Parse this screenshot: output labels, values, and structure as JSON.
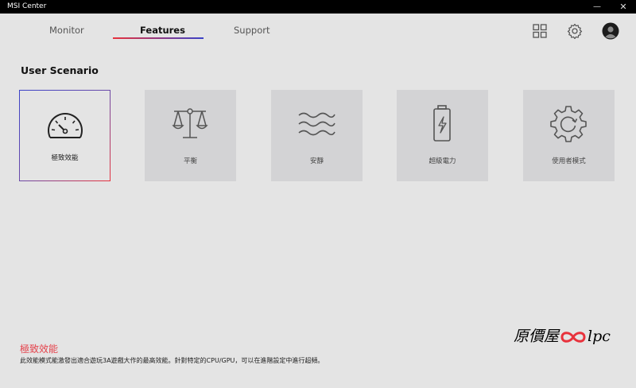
{
  "window": {
    "title": "MSI Center",
    "minimize_glyph": "—",
    "close_glyph": "✕"
  },
  "tabs": [
    {
      "label": "Monitor",
      "active": false
    },
    {
      "label": "Features",
      "active": true
    },
    {
      "label": "Support",
      "active": false
    }
  ],
  "header_icons": [
    "grid-icon",
    "gear-icon",
    "avatar-icon"
  ],
  "section_title": "User Scenario",
  "scenarios": [
    {
      "label": "極致效能",
      "icon": "speedometer-icon",
      "selected": true
    },
    {
      "label": "平衡",
      "icon": "balance-scale-icon",
      "selected": false
    },
    {
      "label": "安靜",
      "icon": "waves-icon",
      "selected": false
    },
    {
      "label": "超級電力",
      "icon": "battery-charging-icon",
      "selected": false
    },
    {
      "label": "使用者模式",
      "icon": "gear-icon",
      "selected": false
    }
  ],
  "description": {
    "title": "極致效能",
    "text": "此效能模式能激發出適合遊玩3A遊戲大作的最高效能。針對特定的CPU/GPU，可以在進階設定中進行超頻。"
  },
  "watermark": {
    "prefix": "原價屋",
    "suffix": "lpc"
  },
  "colors": {
    "accent_red": "#e5424b",
    "accent_blue": "#3a42c8",
    "background": "#e4e4e4",
    "card": "#d3d3d5"
  }
}
